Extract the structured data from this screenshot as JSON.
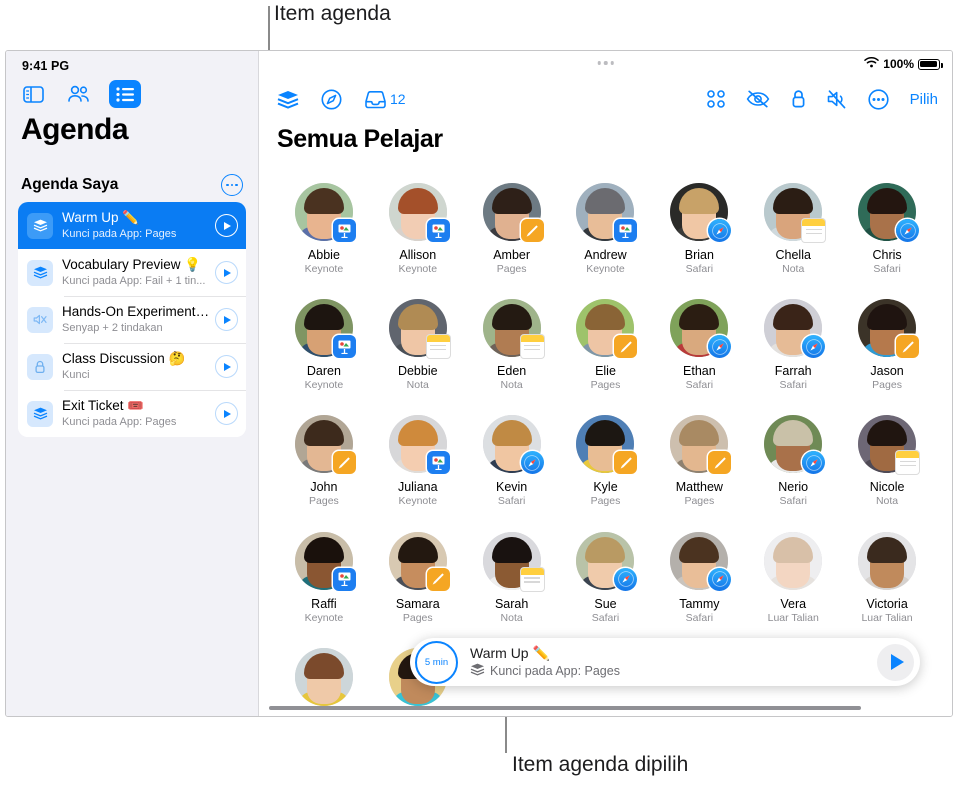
{
  "annotations": {
    "top_label": "Item agenda",
    "bottom_label": "Item agenda dipilih"
  },
  "status_bar": {
    "time": "9:41 PG",
    "battery_percent": "100%",
    "wifi_icon": "wifi-icon",
    "battery_icon": "battery-icon"
  },
  "sidebar": {
    "top_icons": [
      {
        "name": "sidebar-toggle-icon",
        "selected": false
      },
      {
        "name": "people-icon",
        "selected": false
      },
      {
        "name": "list-icon",
        "selected": true
      }
    ],
    "title": "Agenda",
    "section_label": "Agenda Saya",
    "section_more_icon": "more-circle-icon",
    "items": [
      {
        "icon": "layers-icon",
        "title": "Warm Up ✏️",
        "subtitle": "Kunci pada App: Pages",
        "selected": true,
        "action_icon": "play-icon"
      },
      {
        "icon": "layers-icon",
        "title": "Vocabulary Preview 💡",
        "subtitle": "Kunci pada App: Fail + 1 tin...",
        "selected": false,
        "action_icon": "play-icon"
      },
      {
        "icon": "mute-icon",
        "title": "Hands-On Experiment 🧪",
        "subtitle": "Senyap + 2 tindakan",
        "selected": false,
        "action_icon": "play-icon"
      },
      {
        "icon": "lock-icon",
        "title": "Class Discussion 🤔",
        "subtitle": "Kunci",
        "selected": false,
        "action_icon": "play-icon"
      },
      {
        "icon": "layers-icon",
        "title": "Exit Ticket 🎟️",
        "subtitle": "Kunci pada App: Pages",
        "selected": false,
        "action_icon": "play-icon"
      }
    ]
  },
  "toolbar": {
    "left_icons": [
      {
        "name": "layers-icon",
        "label": ""
      },
      {
        "name": "compass-icon",
        "label": ""
      },
      {
        "name": "inbox-icon",
        "label": "12"
      }
    ],
    "right_icons": [
      {
        "name": "grid-four-icon"
      },
      {
        "name": "eye-slash-icon"
      },
      {
        "name": "lock-icon"
      },
      {
        "name": "mute-icon"
      },
      {
        "name": "more-circle-icon"
      }
    ],
    "select_label": "Pilih"
  },
  "main": {
    "title": "Semua Pelajar",
    "students": [
      {
        "name": "Abbie",
        "app": "Keynote",
        "badge": "keynote",
        "skin": "#e8b48f",
        "hair": "#4a3220",
        "bg": "#a7c5a0",
        "shirt": "#5b6fa8"
      },
      {
        "name": "Allison",
        "app": "Keynote",
        "badge": "keynote",
        "skin": "#f2cdb4",
        "hair": "#a4502a",
        "bg": "#cfd6cf",
        "shirt": "#d8d2cc"
      },
      {
        "name": "Amber",
        "app": "Pages",
        "badge": "pages",
        "skin": "#e0b190",
        "hair": "#2e2018",
        "bg": "#6d7a83",
        "shirt": "#3b3b40"
      },
      {
        "name": "Andrew",
        "app": "Keynote",
        "badge": "keynote",
        "skin": "#e8bd98",
        "hair": "#6b6b70",
        "bg": "#9fb0be",
        "shirt": "#33383d"
      },
      {
        "name": "Brian",
        "app": "Safari",
        "badge": "safari",
        "skin": "#f0c7a5",
        "hair": "#c8a268",
        "bg": "#2a2a28",
        "shirt": "#3a3a38"
      },
      {
        "name": "Chella",
        "app": "Nota",
        "badge": "notes",
        "skin": "#d9a47c",
        "hair": "#2b1d14",
        "bg": "#b9c9cd",
        "shirt": "#cfd9dd"
      },
      {
        "name": "Chris",
        "app": "Safari",
        "badge": "safari",
        "skin": "#a9724a",
        "hair": "#241610",
        "bg": "#2f6b58",
        "shirt": "#1f5144"
      },
      {
        "name": "Daren",
        "app": "Keynote",
        "badge": "keynote",
        "skin": "#d7a174",
        "hair": "#1d1510",
        "bg": "#7f9563",
        "shirt": "#2f4f6d"
      },
      {
        "name": "Debbie",
        "app": "Nota",
        "badge": "notes",
        "skin": "#efc6a6",
        "hair": "#b08b54",
        "bg": "#60656e",
        "shirt": "#4a5057"
      },
      {
        "name": "Eden",
        "app": "Nota",
        "badge": "notes",
        "skin": "#b07c52",
        "hair": "#241a12",
        "bg": "#9fb48a",
        "shirt": "#6e6259"
      },
      {
        "name": "Elie",
        "app": "Pages",
        "badge": "pages",
        "skin": "#eec5a5",
        "hair": "#8a6436",
        "bg": "#9ec36b",
        "shirt": "#7f96a8"
      },
      {
        "name": "Ethan",
        "app": "Safari",
        "badge": "safari",
        "skin": "#d9a97e",
        "hair": "#2b1d12",
        "bg": "#7fa25a",
        "shirt": "#b83a3a"
      },
      {
        "name": "Farrah",
        "app": "Safari",
        "badge": "safari",
        "skin": "#e6bb96",
        "hair": "#3a2418",
        "bg": "#cfcfd6",
        "shirt": "#e3e0dd"
      },
      {
        "name": "Jason",
        "app": "Pages",
        "badge": "pages",
        "skin": "#b5794c",
        "hair": "#1f1410",
        "bg": "#3b3328",
        "shirt": "#2e9bd4"
      },
      {
        "name": "John",
        "app": "Pages",
        "badge": "pages",
        "skin": "#e3b793",
        "hair": "#3d2a1c",
        "bg": "#b1a695",
        "shirt": "#7a7a7a"
      },
      {
        "name": "Juliana",
        "app": "Keynote",
        "badge": "keynote",
        "skin": "#f4cdb0",
        "hair": "#cf8a3c",
        "bg": "#d7d7d9",
        "shirt": "#e0dcd8"
      },
      {
        "name": "Kevin",
        "app": "Safari",
        "badge": "safari",
        "skin": "#f0c6a2",
        "hair": "#c08a44",
        "bg": "#dcdfe2",
        "shirt": "#2f3d52"
      },
      {
        "name": "Kyle",
        "app": "Pages",
        "badge": "pages",
        "skin": "#e8bd94",
        "hair": "#1c1712",
        "bg": "#4f7fb5",
        "shirt": "#e8c83c"
      },
      {
        "name": "Matthew",
        "app": "Pages",
        "badge": "pages",
        "skin": "#e3b78f",
        "hair": "#a98a63",
        "bg": "#cdbfae",
        "shirt": "#8e8170"
      },
      {
        "name": "Nerio",
        "app": "Safari",
        "badge": "safari",
        "skin": "#a9714a",
        "hair": "#c9c1a8",
        "bg": "#6f8a55",
        "shirt": "#e8e8e8"
      },
      {
        "name": "Nicole",
        "app": "Nota",
        "badge": "notes",
        "skin": "#a06a42",
        "hair": "#201510",
        "bg": "#6d6775",
        "shirt": "#4f4a55"
      },
      {
        "name": "Raffi",
        "app": "Keynote",
        "badge": "keynote",
        "skin": "#8a5632",
        "hair": "#1a110c",
        "bg": "#c8bda8",
        "shirt": "#1f6f7a"
      },
      {
        "name": "Samara",
        "app": "Pages",
        "badge": "pages",
        "skin": "#c68d5e",
        "hair": "#231810",
        "bg": "#d8c9b2",
        "shirt": "#4a4f58"
      },
      {
        "name": "Sarah",
        "app": "Nota",
        "badge": "notes",
        "skin": "#8b5a33",
        "hair": "#191210",
        "bg": "#d9d9dd",
        "shirt": "#efefef"
      },
      {
        "name": "Sue",
        "app": "Safari",
        "badge": "safari",
        "skin": "#f0cbab",
        "hair": "#b99a63",
        "bg": "#b9c3a8",
        "shirt": "#3b4450"
      },
      {
        "name": "Tammy",
        "app": "Safari",
        "badge": "safari",
        "skin": "#e9be98",
        "hair": "#4b3320",
        "bg": "#b4b0ab",
        "shirt": "#cac4bd"
      },
      {
        "name": "Vera",
        "app": "Luar Talian",
        "badge": "none",
        "skin": "#f3d6c2",
        "hair": "#d8c0a8",
        "bg": "#eeeef0",
        "shirt": "#e6e2de"
      },
      {
        "name": "Victoria",
        "app": "Luar Talian",
        "badge": "none",
        "skin": "#c08a5c",
        "hair": "#3a2a1e",
        "bg": "#e4e4e6",
        "shirt": "#d6d2cf"
      },
      {
        "name": "",
        "app": "",
        "badge": "none",
        "skin": "#efc9a8",
        "hair": "#7b4a2c",
        "bg": "#cdd6d9",
        "shirt": "#e6c63c"
      },
      {
        "name": "",
        "app": "",
        "badge": "none",
        "skin": "#c08a5c",
        "hair": "#241810",
        "bg": "#e8d08a",
        "shirt": "#37c2d6"
      }
    ]
  },
  "now_playing": {
    "duration": "5 min",
    "title": "Warm Up ✏️",
    "subtitle": "Kunci pada App: Pages",
    "subtitle_icon": "layers-icon",
    "play_icon": "play-icon"
  },
  "colors": {
    "accent": "#0a84ff",
    "selected_row": "#0a7cf3",
    "sidebar_bg": "#f2f2f7",
    "secondary_text": "#8e8e93"
  }
}
